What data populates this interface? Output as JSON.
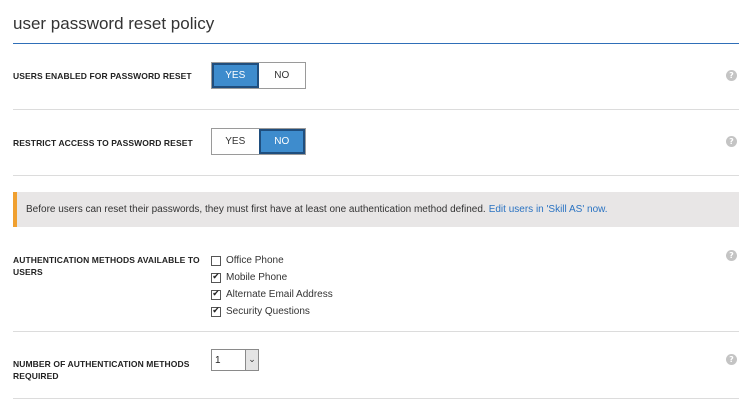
{
  "page": {
    "title": "user password reset policy"
  },
  "users_enabled": {
    "label": "USERS ENABLED FOR PASSWORD RESET",
    "yes": "YES",
    "no": "NO",
    "selected": "YES",
    "help": "?"
  },
  "restrict_access": {
    "label": "RESTRICT ACCESS TO PASSWORD RESET",
    "yes": "YES",
    "no": "NO",
    "selected": "NO",
    "help": "?"
  },
  "notice": {
    "text": "Before users can reset their passwords, they must first have at least one authentication method defined.",
    "link": "Edit users in 'Skill AS' now."
  },
  "auth_methods": {
    "label": "AUTHENTICATION METHODS AVAILABLE TO USERS",
    "help": "?",
    "options": [
      {
        "label": "Office Phone",
        "checked": false,
        "mark": ""
      },
      {
        "label": "Mobile Phone",
        "checked": true,
        "mark": "✔"
      },
      {
        "label": "Alternate Email Address",
        "checked": true,
        "mark": "✔"
      },
      {
        "label": "Security Questions",
        "checked": true,
        "mark": "✔"
      }
    ]
  },
  "num_methods": {
    "label": "NUMBER OF AUTHENTICATION METHODS REQUIRED",
    "value": "1",
    "arrow": "⌄",
    "help": "?"
  },
  "colors": {
    "accent": "#3e8ccd",
    "link": "#2a73c2",
    "notice_bar": "#f0a030",
    "title_rule": "#2f6fb8"
  },
  "icons": {
    "help": "help-icon",
    "dropdown": "chevron-down-icon",
    "check": "checkmark-icon"
  }
}
